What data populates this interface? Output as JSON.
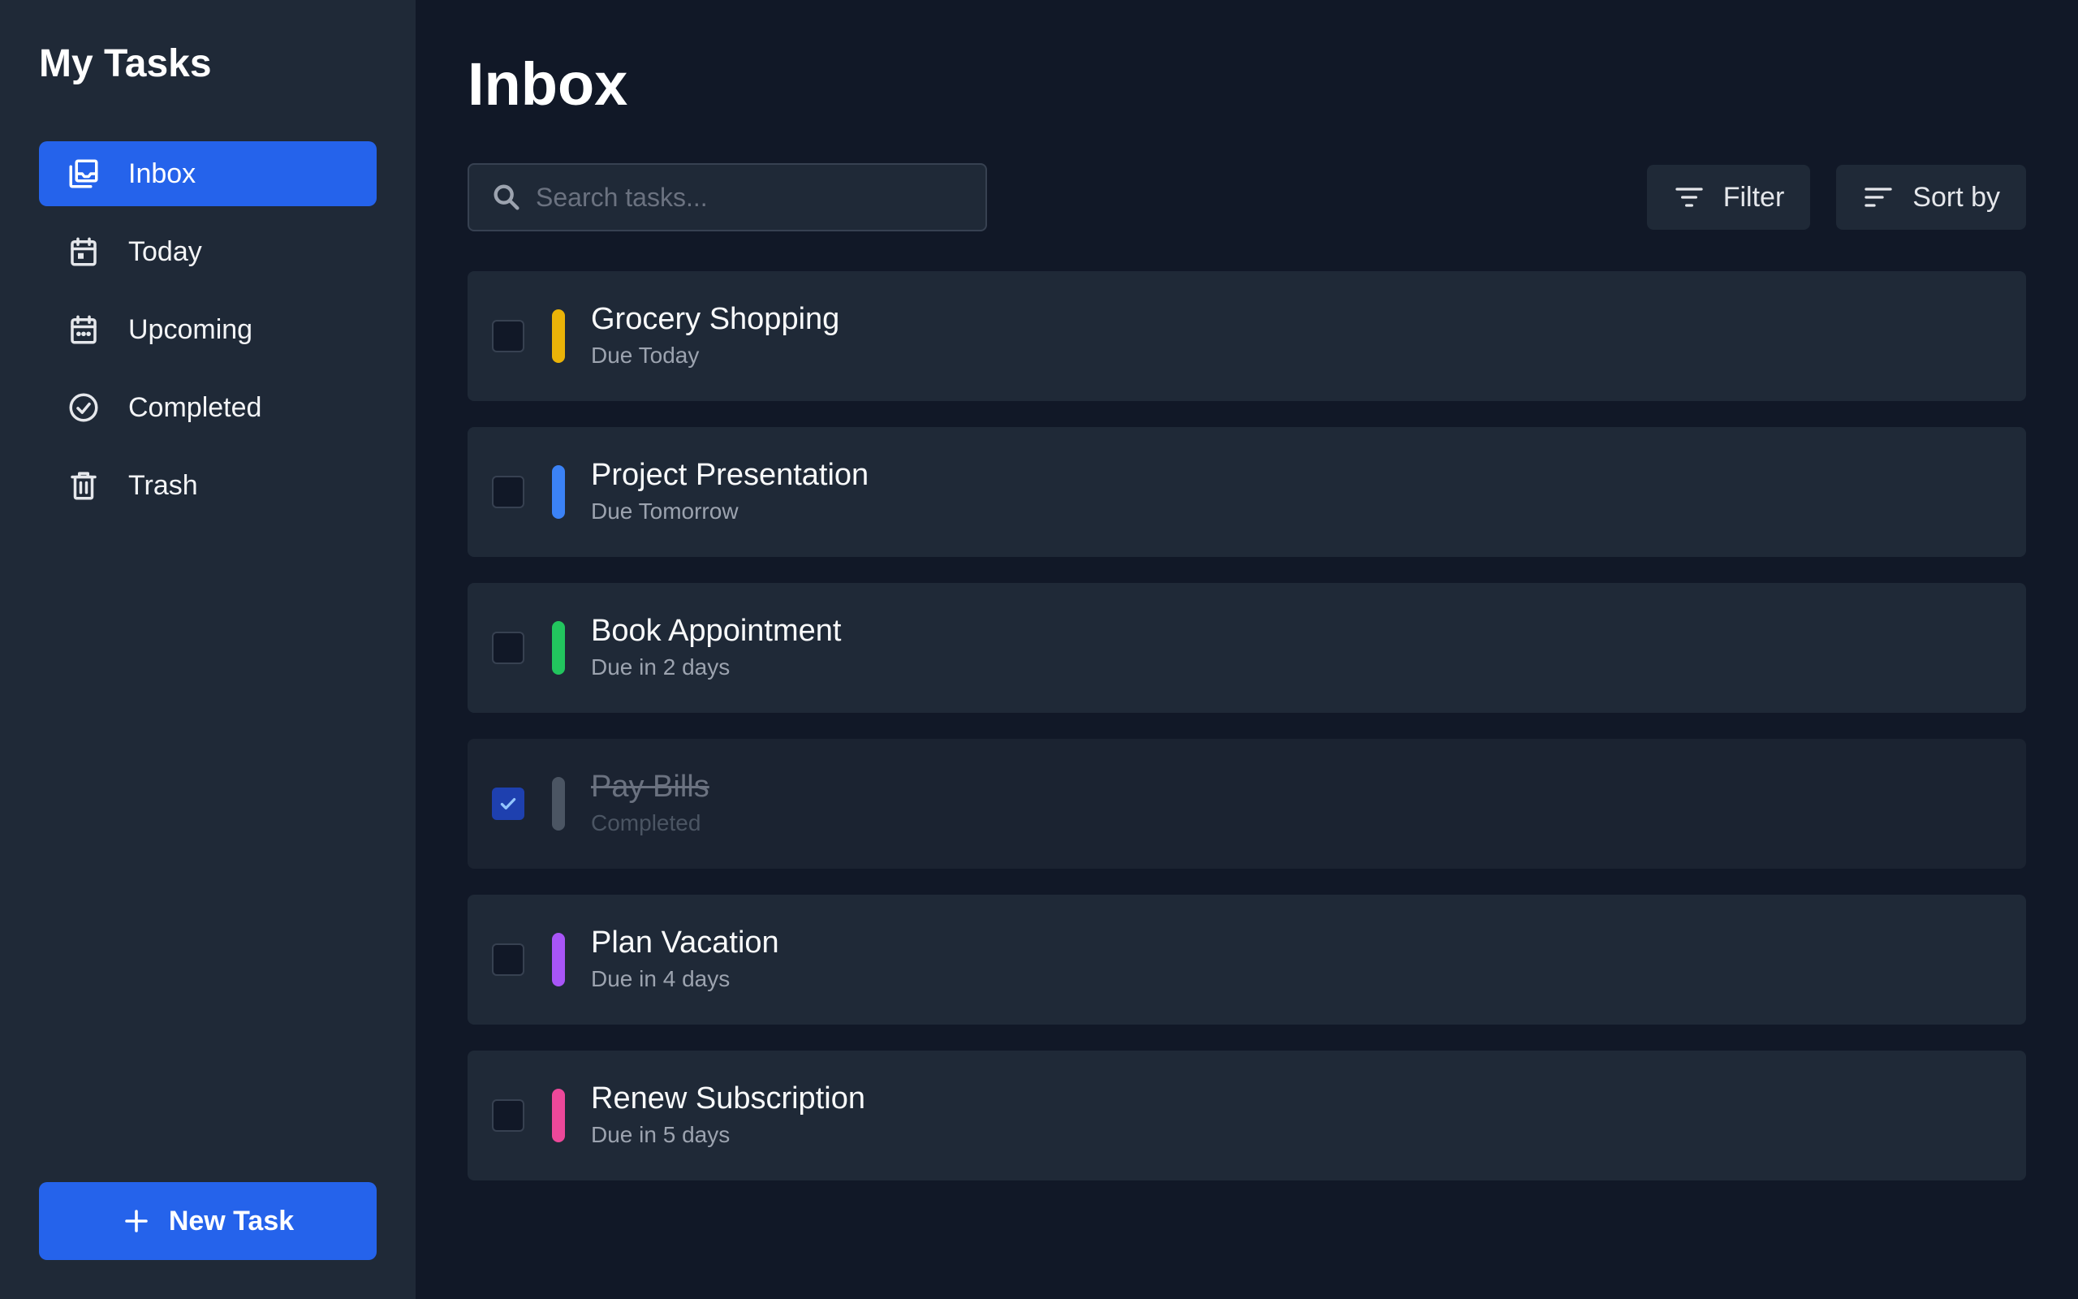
{
  "sidebar": {
    "title": "My Tasks",
    "items": [
      {
        "label": "Inbox",
        "icon": "inbox-icon",
        "active": true
      },
      {
        "label": "Today",
        "icon": "calendar-today-icon",
        "active": false
      },
      {
        "label": "Upcoming",
        "icon": "calendar-upcoming-icon",
        "active": false
      },
      {
        "label": "Completed",
        "icon": "check-circle-icon",
        "active": false
      },
      {
        "label": "Trash",
        "icon": "trash-icon",
        "active": false
      }
    ],
    "new_task_label": "New Task"
  },
  "main": {
    "title": "Inbox",
    "search": {
      "placeholder": "Search tasks..."
    },
    "filter_label": "Filter",
    "sort_label": "Sort by",
    "tasks": [
      {
        "title": "Grocery Shopping",
        "due": "Due Today",
        "color": "#eab308",
        "completed": false
      },
      {
        "title": "Project Presentation",
        "due": "Due Tomorrow",
        "color": "#3b82f6",
        "completed": false
      },
      {
        "title": "Book Appointment",
        "due": "Due in 2 days",
        "color": "#22c55e",
        "completed": false
      },
      {
        "title": "Pay Bills",
        "due": "Completed",
        "color": "#4b5563",
        "completed": true
      },
      {
        "title": "Plan Vacation",
        "due": "Due in 4 days",
        "color": "#a855f7",
        "completed": false
      },
      {
        "title": "Renew Subscription",
        "due": "Due in 5 days",
        "color": "#ec4899",
        "completed": false
      }
    ]
  },
  "colors": {
    "accent": "#2563eb",
    "background": "#111827",
    "panel": "#1f2937"
  }
}
